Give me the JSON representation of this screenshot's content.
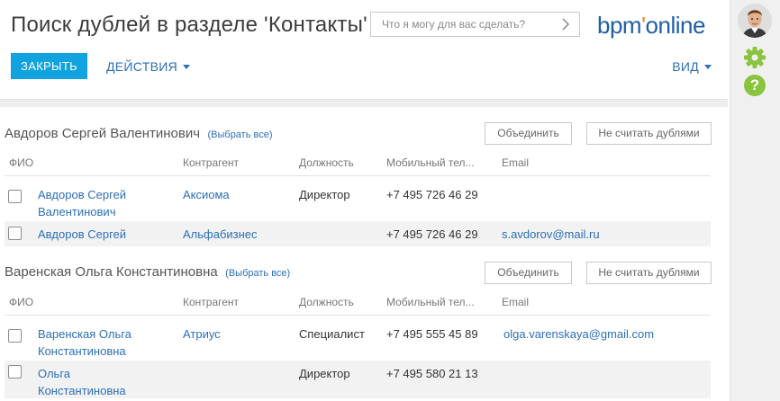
{
  "header": {
    "title": "Поиск дублей в разделе 'Контакты'",
    "command_placeholder": "Что я могу для вас сделать?",
    "logo_main": "bpm",
    "logo_accent": "'",
    "logo_tail": "online"
  },
  "toolbar": {
    "close_label": "ЗАКРЫТЬ",
    "actions_label": "ДЕЙСТВИЯ",
    "view_label": "ВИД"
  },
  "columns": {
    "name": "ФИО",
    "account": "Контрагент",
    "job": "Должность",
    "mobile": "Мобильный тел...",
    "email": "Email"
  },
  "groups": [
    {
      "name": "Авдоров Сергей Валентинович",
      "select_all": "(Выбрать все)",
      "merge_label": "Объединить",
      "not_duplicates_label": "Не считать дублями",
      "rows": [
        {
          "name_line1": "Авдоров Сергей",
          "name_line2": "Валентинович",
          "account": "Аксиома",
          "job": "Директор",
          "mobile": "+7 495 726 46 29",
          "email": ""
        },
        {
          "name_line1": "Авдоров Сергей",
          "name_line2": "",
          "account": "Альфабизнес",
          "job": "",
          "mobile": "+7 495 726 46 29",
          "email": "s.avdorov@mail.ru"
        }
      ]
    },
    {
      "name": "Варенская Ольга Константиновна",
      "select_all": "(Выбрать все)",
      "merge_label": "Объединить",
      "not_duplicates_label": "Не считать дублями",
      "rows": [
        {
          "name_line1": "Варенская Ольга",
          "name_line2": "Константиновна",
          "account": "Атриус",
          "job": "Специалист",
          "mobile": "+7 495 555 45 89",
          "email": "olga.varenskaya@gmail.com"
        },
        {
          "name_line1": "Ольга",
          "name_line2": "Константиновна",
          "account": "",
          "job": "Директор",
          "mobile": "+7 495 580 21 13",
          "email": ""
        }
      ]
    }
  ],
  "icons": {
    "command_arrow": "chevron-right-icon",
    "settings": "gear-icon",
    "help": "help-icon",
    "help_glyph": "?"
  },
  "colors": {
    "accent": "#10a3e0",
    "link": "#2c6fb7",
    "logo_blue": "#1f5fa6",
    "logo_orange": "#f08a24",
    "gear_green": "#8ac43f"
  }
}
